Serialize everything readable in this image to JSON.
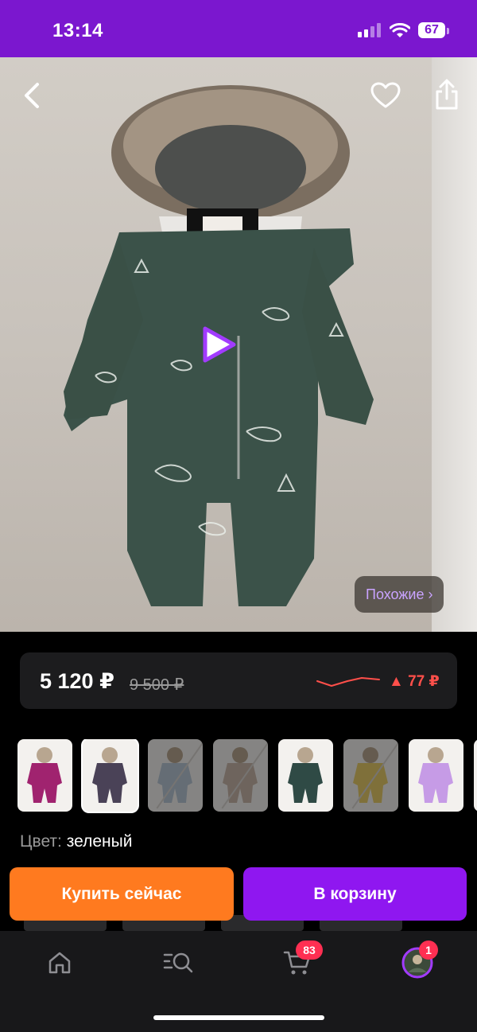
{
  "status_bar": {
    "time": "13:14",
    "battery": "67"
  },
  "product": {
    "similar_label": "Похожие ›",
    "price": "5 120 ₽",
    "old_price": "9 500 ₽",
    "price_change": "▲ 77 ₽",
    "color_label": "Цвет:",
    "color_value": "зеленый"
  },
  "actions": {
    "buy_now": "Купить сейчас",
    "add_to_cart": "В корзину"
  },
  "tab_bar": {
    "cart_badge": "83",
    "profile_badge": "1"
  },
  "colors": {
    "accent": "#7b17cf",
    "buy": "#ff7a1f",
    "cart": "#8f17f0",
    "price_up": "#ff4f4a"
  },
  "thumbnails": [
    {
      "color": "#a0236f",
      "available": true
    },
    {
      "color": "#4a4257",
      "available": true,
      "selected": true
    },
    {
      "color": "#b8c7d6",
      "available": false
    },
    {
      "color": "#c9b6a9",
      "available": false
    },
    {
      "color": "#2f4a45",
      "available": true
    },
    {
      "color": "#e8cc6b",
      "available": false
    },
    {
      "color": "#c69be6",
      "available": true
    },
    {
      "color": "#ddd",
      "available": true
    }
  ]
}
